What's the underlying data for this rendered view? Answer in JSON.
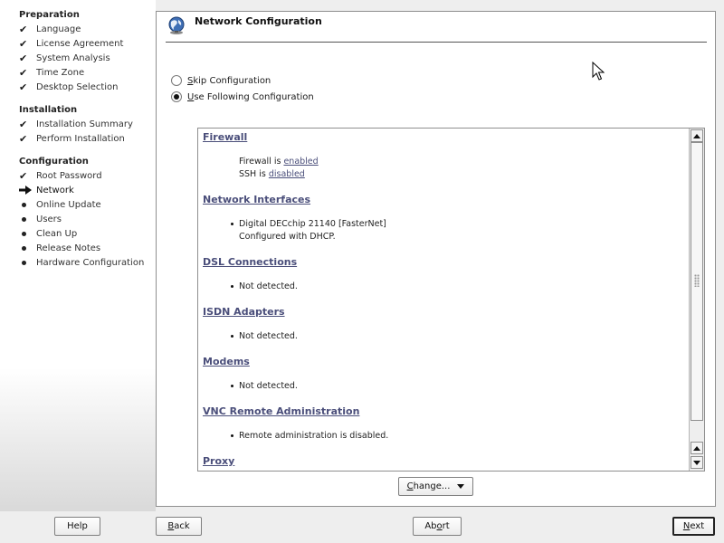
{
  "sidebar": {
    "sections": [
      {
        "title": "Preparation",
        "steps": [
          {
            "label": "Language",
            "status": "done"
          },
          {
            "label": "License Agreement",
            "status": "done"
          },
          {
            "label": "System Analysis",
            "status": "done"
          },
          {
            "label": "Time Zone",
            "status": "done"
          },
          {
            "label": "Desktop Selection",
            "status": "done"
          }
        ]
      },
      {
        "title": "Installation",
        "steps": [
          {
            "label": "Installation Summary",
            "status": "done"
          },
          {
            "label": "Perform Installation",
            "status": "done"
          }
        ]
      },
      {
        "title": "Configuration",
        "steps": [
          {
            "label": "Root Password",
            "status": "done"
          },
          {
            "label": "Network",
            "status": "current"
          },
          {
            "label": "Online Update",
            "status": "pending"
          },
          {
            "label": "Users",
            "status": "pending"
          },
          {
            "label": "Clean Up",
            "status": "pending"
          },
          {
            "label": "Release Notes",
            "status": "pending"
          },
          {
            "label": "Hardware Configuration",
            "status": "pending"
          }
        ]
      }
    ]
  },
  "header": {
    "title": "Network Configuration",
    "icon": "network-globe-icon"
  },
  "options": {
    "skip": {
      "label_first": "S",
      "label_rest": "kip Configuration",
      "selected": false
    },
    "use": {
      "label_first": "U",
      "label_rest": "se Following Configuration",
      "selected": true
    }
  },
  "summary": {
    "firewall": {
      "heading": "Firewall",
      "line1_prefix": "Firewall is ",
      "line1_link": "enabled",
      "line2_prefix": "SSH is ",
      "line2_link": "disabled"
    },
    "network_interfaces": {
      "heading": "Network Interfaces",
      "item_line1": "Digital DECchip 21140 [FasterNet]",
      "item_line2": "Configured with DHCP."
    },
    "dsl": {
      "heading": "DSL Connections",
      "item": "Not detected."
    },
    "isdn": {
      "heading": "ISDN Adapters",
      "item": "Not detected."
    },
    "modems": {
      "heading": "Modems",
      "item": "Not detected."
    },
    "vnc": {
      "heading": "VNC Remote Administration",
      "item": "Remote administration is disabled."
    },
    "proxy": {
      "heading": "Proxy"
    }
  },
  "change_button": {
    "label_first": "C",
    "label_rest": "hange..."
  },
  "footer": {
    "help": "Help",
    "back_first": "B",
    "back_rest": "ack",
    "abort_first": "Ab",
    "abort_mn": "o",
    "abort_rest": "rt",
    "next_first": "N",
    "next_rest": "ext"
  },
  "colors": {
    "link": "#4a4e7a",
    "accent": "#111111"
  }
}
